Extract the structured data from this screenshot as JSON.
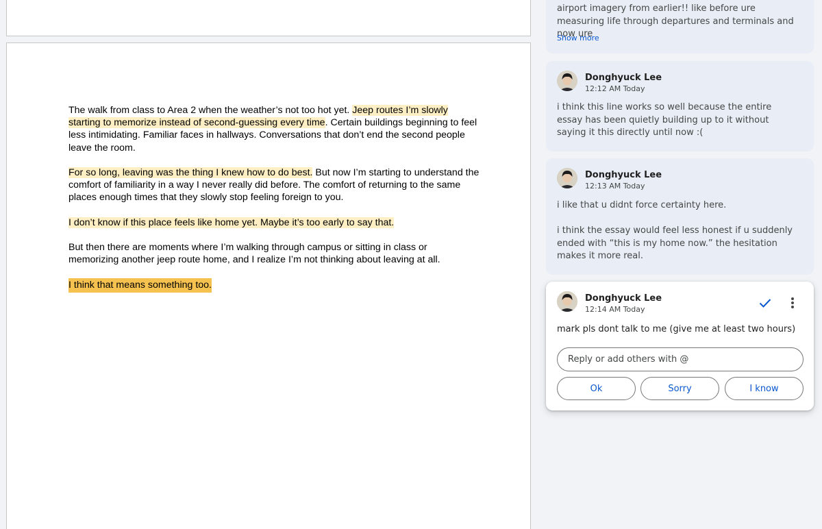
{
  "document": {
    "paragraphs": [
      {
        "segments": [
          {
            "text": "The walk from class to Area 2 when the weather’s not too hot yet. ",
            "hl": ""
          },
          {
            "text": "Jeep routes I’m slowly starting to memorize instead of second-guessing every time",
            "hl": "light"
          },
          {
            "text": ". Certain buildings beginning to feel less intimidating. Familiar faces in hallways. Conversations that don’t end the second people leave the room.",
            "hl": ""
          }
        ]
      },
      {
        "segments": [
          {
            "text": "For so long, leaving was the thing I knew how to do best.",
            "hl": "light"
          },
          {
            "text": " But now I’m starting to understand the comfort of familiarity in a way I never really did before. The comfort of returning to the same places enough times that they slowly stop feeling foreign to you.",
            "hl": ""
          }
        ]
      },
      {
        "segments": [
          {
            "text": "I don’t know if this place feels like home yet. Maybe it’s too early to say that.",
            "hl": "light"
          }
        ]
      },
      {
        "segments": [
          {
            "text": "But then there are moments where I’m walking through campus or sitting in class or memorizing another jeep route home, and I realize I’m not thinking about leaving at all.",
            "hl": ""
          }
        ]
      },
      {
        "segments": [
          {
            "text": "I think that means something too.",
            "hl": "strong"
          }
        ]
      }
    ]
  },
  "comments": {
    "previous": {
      "text": "airport imagery from earlier!! like before ure measuring life through departures and terminals and now ure",
      "show_more": "Show more"
    },
    "items": [
      {
        "author": "Donghyuck Lee",
        "time": "12:12 AM Today",
        "paragraphs": [
          "i think this line works so well because the entire essay has been quietly building up to it without saying it this directly until now :("
        ]
      },
      {
        "author": "Donghyuck Lee",
        "time": "12:13 AM Today",
        "paragraphs": [
          "i like that u didnt force certainty here.",
          "i think the essay would feel less honest if u suddenly ended with “this is my home now.” the hesitation makes it more real."
        ]
      }
    ],
    "active": {
      "author": "Donghyuck Lee",
      "time": "12:14 AM Today",
      "text": "mark pls dont talk to me (give me at least two hours)",
      "reply_placeholder": "Reply or add others with @",
      "reply_value": "",
      "quick_replies": [
        "Ok",
        "Sorry",
        "I know"
      ],
      "icons": {
        "resolve": "checkmark-icon",
        "more": "more-vert-icon"
      }
    }
  },
  "colors": {
    "highlight_light": "#fdefc3",
    "highlight_strong": "#f6c24f",
    "accent": "#0b57d0",
    "comment_bg": "#e9eef6",
    "panel_bg": "#f1f3f6"
  }
}
